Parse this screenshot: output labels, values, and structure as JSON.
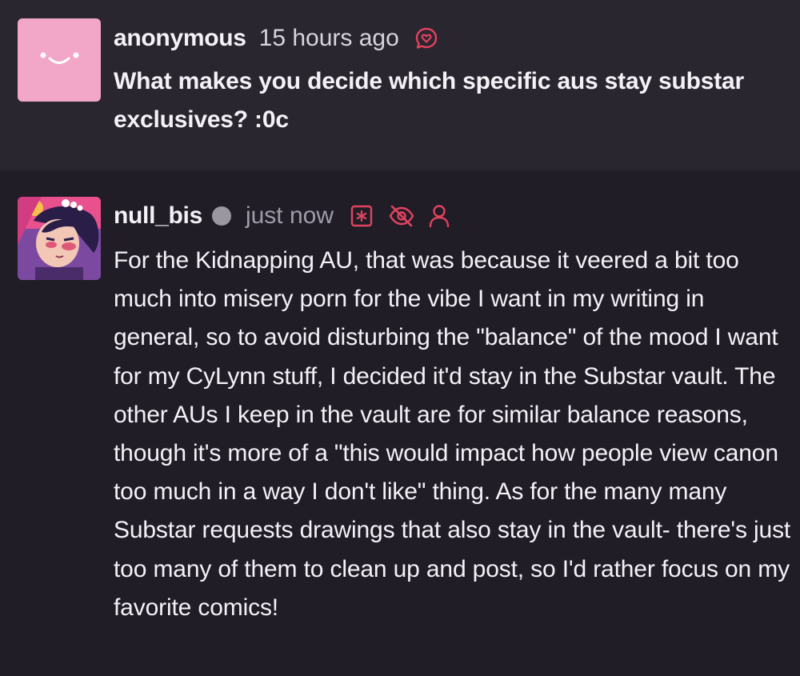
{
  "ask": {
    "username": "anonymous",
    "time": "15 hours ago",
    "question": "What makes you decide which specific aus stay substar exclusives? :0c",
    "icons": {
      "ask_icon": "heart-speech-bubble-icon",
      "avatar": "smiley-face-avatar"
    }
  },
  "answer": {
    "username": "null_bis",
    "time": "just now",
    "status": "offline-dot",
    "icons": [
      "asterisk-box-icon",
      "eye-off-icon",
      "user-icon"
    ],
    "body": "For the Kidnapping AU, that was because it veered a bit too much into misery porn for the vibe I want in my writing in general, so to avoid disturbing the \"balance\" of the mood I want for my CyLynn stuff, I decided it'd stay in the Substar vault. The other AUs I keep in the vault are for similar balance reasons, though it's more of a \"this would impact how people view canon too much in a way I don't like\" thing. As for the many many Substar requests drawings that also stay in the vault- there's just too many of them to clean up and post, so I'd rather focus on my favorite comics!"
  },
  "colors": {
    "ask_bg": "#2a2630",
    "answer_bg": "#201d27",
    "accent": "#e2435f",
    "anon_avatar": "#f2a6c8",
    "status_dot": "#9b97a0"
  }
}
